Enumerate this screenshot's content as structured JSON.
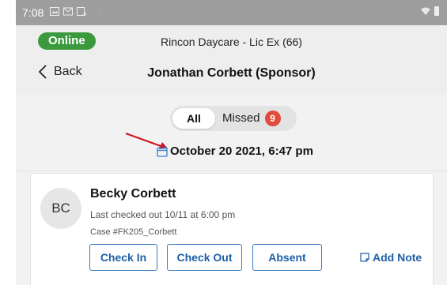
{
  "status_bar": {
    "time": "7:08",
    "icons": [
      "image-icon",
      "mail-icon",
      "screenshot-icon"
    ],
    "dot": "·"
  },
  "header": {
    "online_badge": "Online",
    "facility": "Rincon Daycare - Lic Ex (66)",
    "back_label": "Back",
    "title": "Jonathan Corbett (Sponsor)"
  },
  "filter": {
    "all_label": "All",
    "missed_label": "Missed",
    "missed_count": "9"
  },
  "date": {
    "label": "October 20 2021, 6:47 pm"
  },
  "child": {
    "initials": "BC",
    "name": "Becky Corbett",
    "last_checked": "Last checked out 10/11 at 6:00 pm",
    "case": "Case #FK205_Corbett",
    "actions": {
      "check_in": "Check In",
      "check_out": "Check Out",
      "absent": "Absent",
      "add_note": "Add Note"
    }
  },
  "colors": {
    "online": "#3a9a3d",
    "missed_badge": "#e14b3b",
    "action_blue": "#1d5fa6",
    "annotation_arrow": "#d0141c"
  }
}
